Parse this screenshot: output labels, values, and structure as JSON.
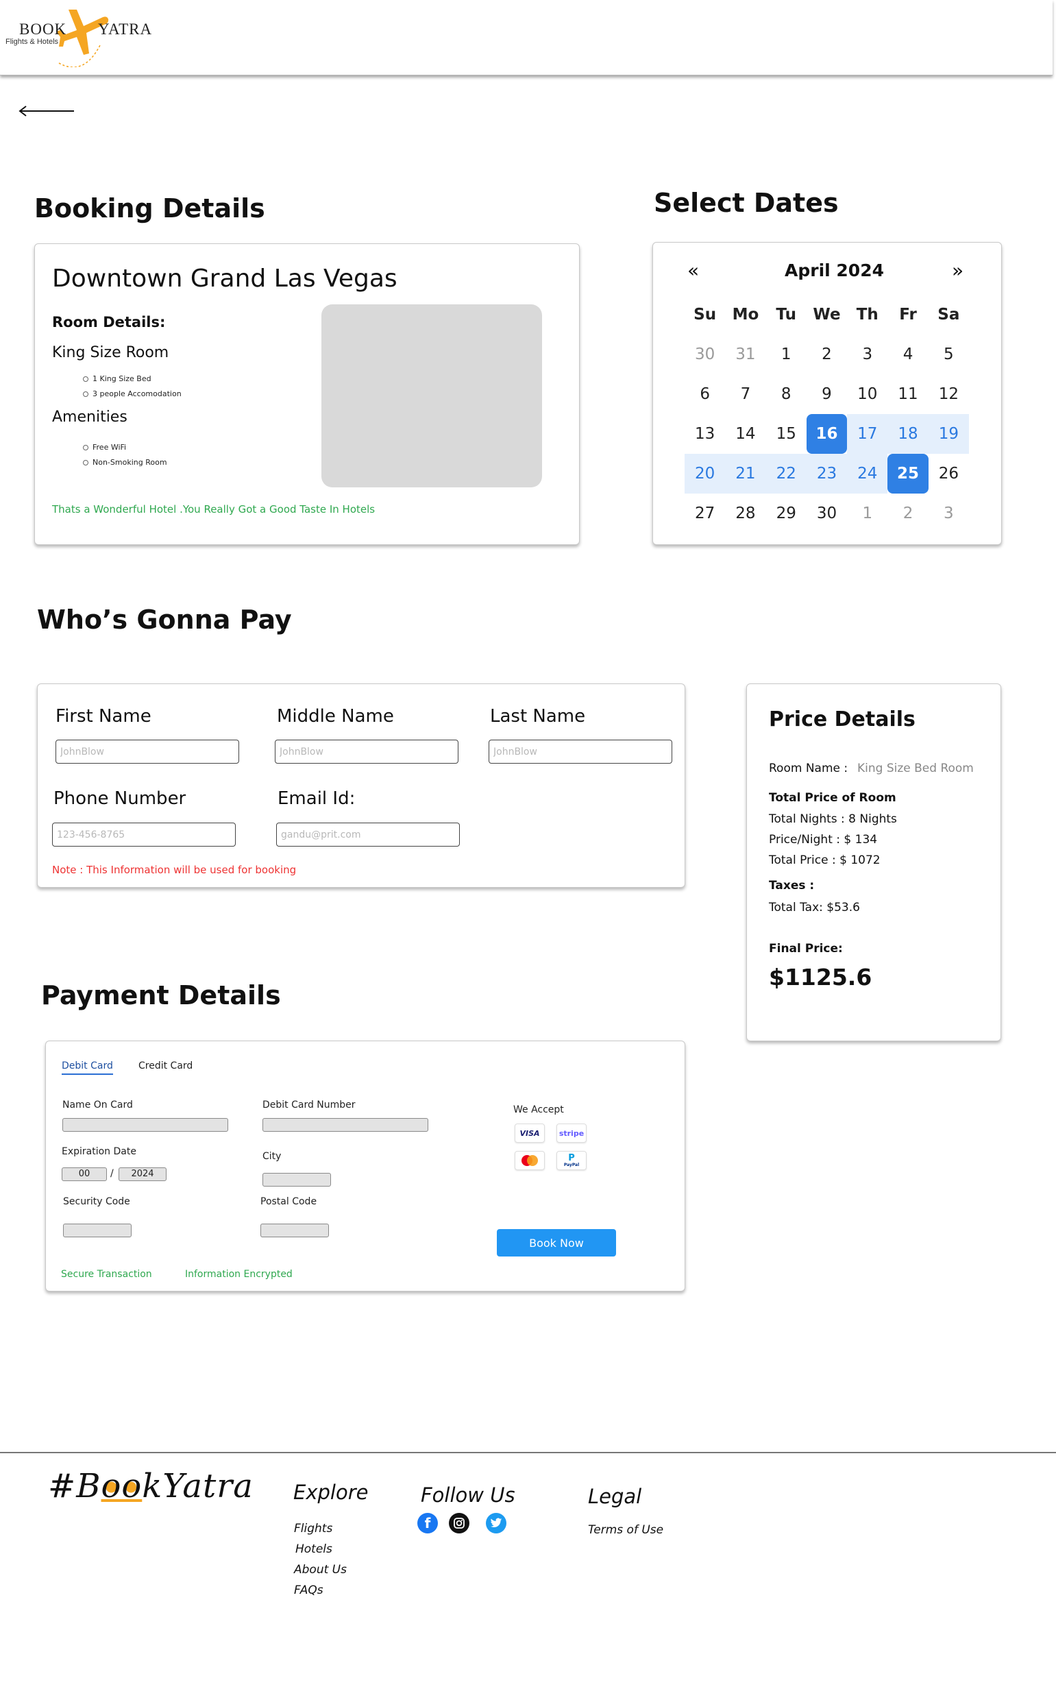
{
  "header": {
    "logo_book": "BOOK",
    "logo_yatra": "YATRA",
    "logo_tagline": "Flights & Hotels"
  },
  "booking": {
    "section_title": "Booking Details",
    "hotel_name": "Downtown Grand Las Vegas",
    "room_details_label": "Room Details:",
    "room_type": "King Size Room",
    "room_features": [
      "1 King Size Bed",
      "3 people Accomodation"
    ],
    "amenities_label": "Amenities",
    "amenities": [
      "Free WiFi",
      "Non-Smoking Room"
    ],
    "note": "Thats a Wonderful Hotel .You Really Got a Good Taste In Hotels"
  },
  "calendar": {
    "section_title": "Select Dates",
    "prev_icon": "«",
    "next_icon": "»",
    "month": "April 2024",
    "weekdays": [
      "Su",
      "Mo",
      "Tu",
      "We",
      "Th",
      "Fr",
      "Sa"
    ],
    "weeks": [
      [
        "30",
        "31",
        "1",
        "2",
        "3",
        "4",
        "5"
      ],
      [
        "6",
        "7",
        "8",
        "9",
        "10",
        "11",
        "12"
      ],
      [
        "13",
        "14",
        "15",
        "16",
        "17",
        "18",
        "19"
      ],
      [
        "20",
        "21",
        "22",
        "23",
        "24",
        "25",
        "26"
      ],
      [
        "27",
        "28",
        "29",
        "30",
        "1",
        "2",
        "3"
      ]
    ],
    "selected_start": "16",
    "selected_end": "25"
  },
  "payer": {
    "section_title": "Who’s Gonna Pay",
    "first_name_label": "First Name",
    "middle_name_label": "Middle Name",
    "last_name_label": "Last Name",
    "name_placeholder": "JohnBlow",
    "phone_label": "Phone Number",
    "phone_placeholder": "123-456-8765",
    "email_label": "Email Id:",
    "email_placeholder": "gandu@prit.com",
    "note": "Note : This Information will be used for booking"
  },
  "price": {
    "title": "Price Details",
    "room_name_label": "Room Name :",
    "room_name_value": "King Size Bed Room",
    "total_price_of_room_label": "Total Price of Room",
    "total_nights": "Total Nights : 8 Nights",
    "price_per_night": "Price/Night : $ 134",
    "total_price": "Total Price : $ 1072",
    "taxes_label": "Taxes :",
    "total_tax": "Total Tax: $53.6",
    "final_price_label": "Final Price:",
    "final_price": "$1125.6"
  },
  "payment": {
    "section_title": "Payment Details",
    "tabs": [
      "Debit Card",
      "Credit Card"
    ],
    "name_on_card_label": "Name On Card",
    "card_number_label": "Debit Card Number",
    "expiration_label": "Expiration Date",
    "exp_month": "00",
    "exp_separator": "/",
    "exp_year": "2024",
    "city_label": "City",
    "security_code_label": "Security Code",
    "postal_code_label": "Postal Code",
    "we_accept_label": "We Accept",
    "visa": "VISA",
    "stripe": "stripe",
    "paypal": "PayPal",
    "book_now": "Book Now",
    "secure_transaction": "Secure Transaction",
    "information_encrypted": "Information Encrypted"
  },
  "footer": {
    "brand_prefix": "#B",
    "brand_oo": "oo",
    "brand_suffix": "kYatra",
    "explore_heading": "Explore",
    "explore_links": [
      "Flights",
      "Hotels",
      "About Us",
      "FAQs"
    ],
    "follow_heading": "Follow Us",
    "legal_heading": "Legal",
    "legal_links": [
      "Terms of Use"
    ]
  },
  "colors": {
    "accent_blue": "#2f80e4",
    "range_blue": "#e4effc",
    "success_green": "#2fa84f",
    "warning_red": "#e33333",
    "button_blue": "#2196f3",
    "logo_orange": "#f5a623"
  }
}
